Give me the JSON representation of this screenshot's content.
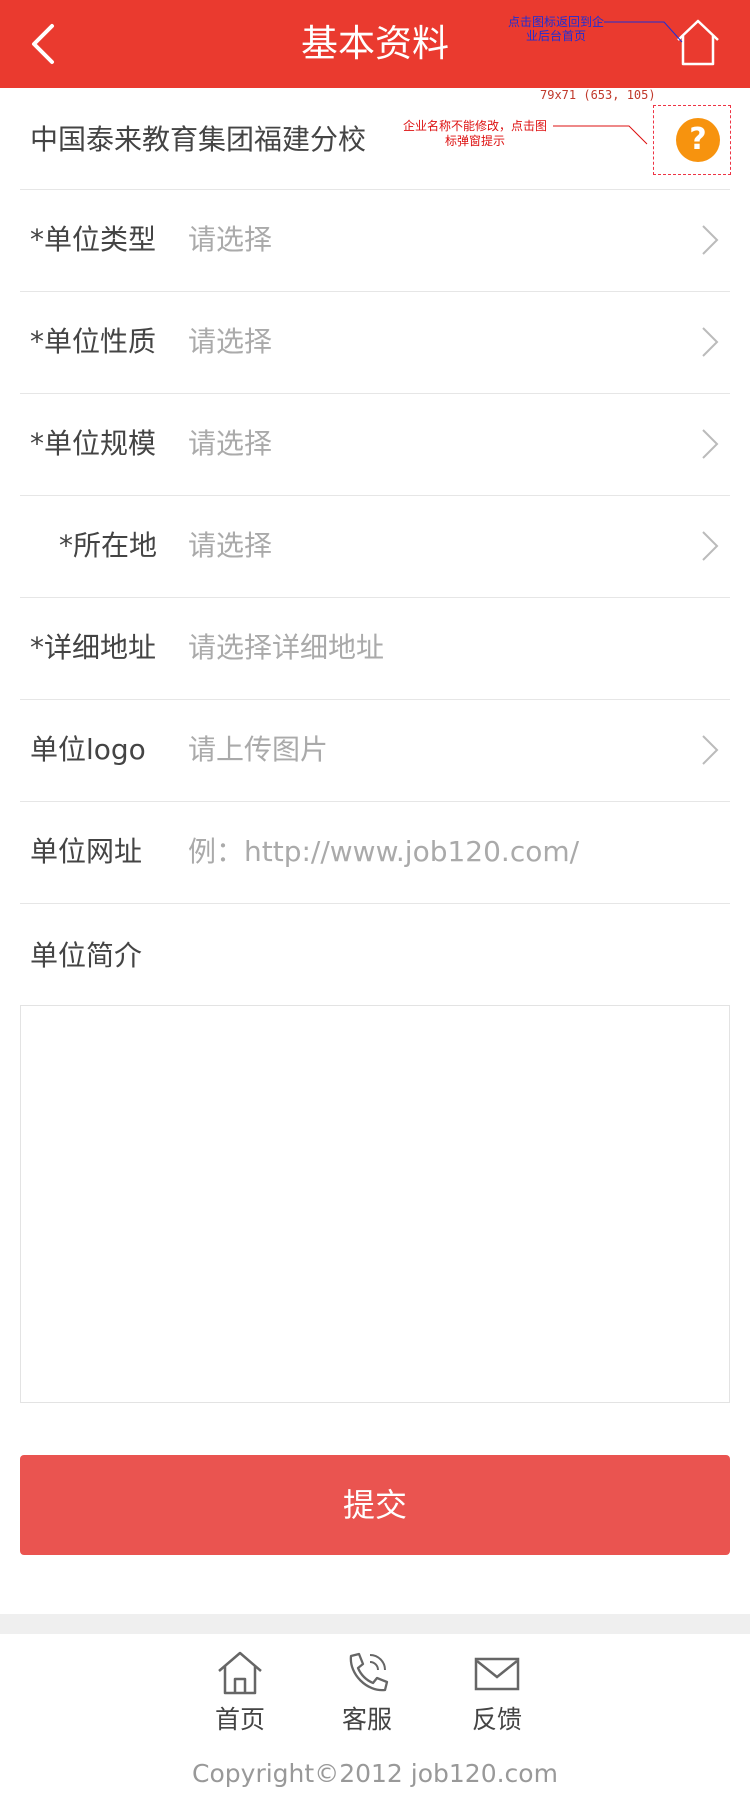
{
  "header": {
    "title": "基本资料",
    "home_annotation": "点击图标返回到企业后台首页"
  },
  "company": {
    "name": "中国泰来教育集团福建分校",
    "help_glyph": "?",
    "annotation_size": "79x71 (653, 105)",
    "annotation_text": "企业名称不能修改，点击图标弹窗提示"
  },
  "form": {
    "rows": [
      {
        "label": "*单位类型",
        "value": "请选择"
      },
      {
        "label": "*单位性质",
        "value": "请选择"
      },
      {
        "label": "*单位规模",
        "value": "请选择"
      },
      {
        "label": "*所在地",
        "value": "请选择"
      },
      {
        "label": "*详细地址",
        "value": "请选择详细地址"
      },
      {
        "label": "单位logo",
        "value": "请上传图片"
      },
      {
        "label": "单位网址",
        "value": "例：http://www.job120.com/"
      }
    ],
    "intro_label": "单位简介",
    "intro_value": ""
  },
  "submit_label": "提交",
  "footer": {
    "items": [
      {
        "label": "首页",
        "icon": "home-icon"
      },
      {
        "label": "客服",
        "icon": "phone-icon"
      },
      {
        "label": "反馈",
        "icon": "mail-icon"
      }
    ],
    "copyright": "Copyright©2012  job120.com"
  },
  "colors": {
    "header_bg": "#ea3a2f",
    "submit_bg": "#ea5450",
    "help_icon": "#f7930e"
  }
}
